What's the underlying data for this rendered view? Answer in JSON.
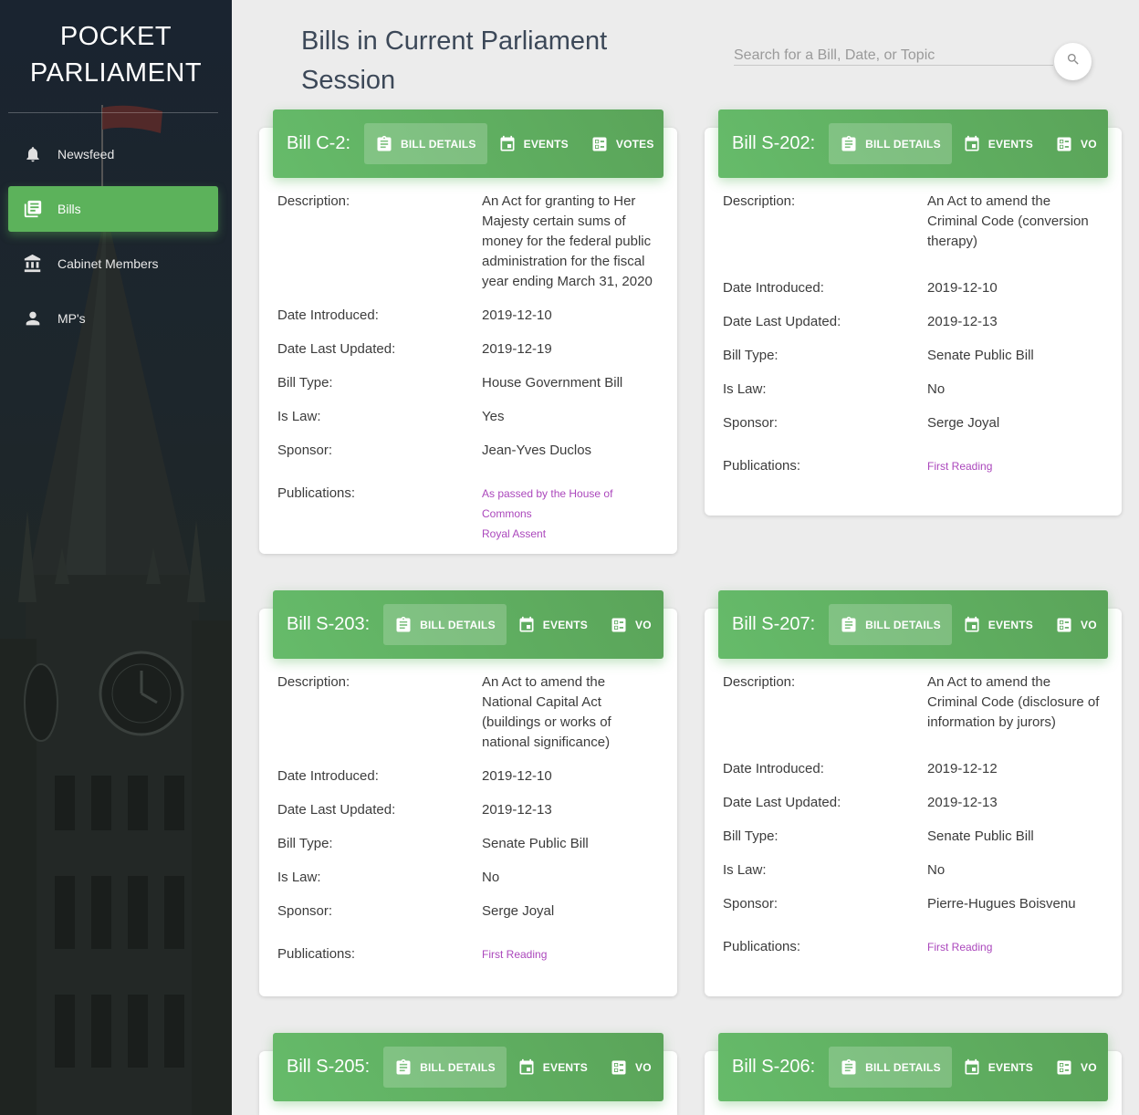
{
  "brand": {
    "line1": "POCKET",
    "line2": "PARLIAMENT"
  },
  "nav": [
    {
      "label": "Newsfeed",
      "icon": "bell-icon",
      "active": false
    },
    {
      "label": "Bills",
      "icon": "library-books-icon",
      "active": true
    },
    {
      "label": "Cabinet Members",
      "icon": "bank-icon",
      "active": false
    },
    {
      "label": "MP's",
      "icon": "person-icon",
      "active": false
    }
  ],
  "header": {
    "title": "Bills in Current Parliament Session",
    "search_placeholder": "Search for a Bill, Date, or Topic"
  },
  "colors": {
    "accent_green": "#5cb25b",
    "link_purple": "#ab47bc",
    "sidebar_dark": "#1d262c"
  },
  "labels": {
    "description": "Description:",
    "date_introduced": "Date Introduced:",
    "date_last_updated": "Date Last Updated:",
    "bill_type": "Bill Type:",
    "is_law": "Is Law:",
    "sponsor": "Sponsor:",
    "publications": "Publications:"
  },
  "bills": [
    {
      "number": "Bill C-2:",
      "tabs": [
        "BILL DETAILS",
        "EVENTS",
        "VOTES"
      ],
      "description": "An Act for granting to Her Majesty certain sums of money for the federal public administration for the fiscal year ending March 31, 2020",
      "date_introduced": "2019-12-10",
      "date_last_updated": "2019-12-19",
      "bill_type": "House Government Bill",
      "is_law": "Yes",
      "sponsor": "Jean-Yves Duclos",
      "publications": [
        "As passed by the House of Commons",
        "Royal Assent"
      ]
    },
    {
      "number": "Bill S-202:",
      "tabs": [
        "BILL DETAILS",
        "EVENTS",
        "VO"
      ],
      "description": "An Act to amend the Criminal Code (conversion therapy)",
      "date_introduced": "2019-12-10",
      "date_last_updated": "2019-12-13",
      "bill_type": "Senate Public Bill",
      "is_law": "No",
      "sponsor": "Serge Joyal",
      "publications": [
        "First Reading"
      ]
    },
    {
      "number": "Bill S-203:",
      "tabs": [
        "BILL DETAILS",
        "EVENTS",
        "VO"
      ],
      "description": "An Act to amend the National Capital Act (buildings or works of national significance)",
      "date_introduced": "2019-12-10",
      "date_last_updated": "2019-12-13",
      "bill_type": "Senate Public Bill",
      "is_law": "No",
      "sponsor": "Serge Joyal",
      "publications": [
        "First Reading"
      ]
    },
    {
      "number": "Bill S-207:",
      "tabs": [
        "BILL DETAILS",
        "EVENTS",
        "VO"
      ],
      "description": "An Act to amend the Criminal Code (disclosure of information by jurors)",
      "date_introduced": "2019-12-12",
      "date_last_updated": "2019-12-13",
      "bill_type": "Senate Public Bill",
      "is_law": "No",
      "sponsor": "Pierre-Hugues Boisvenu",
      "publications": [
        "First Reading"
      ]
    },
    {
      "number": "Bill S-205:",
      "tabs": [
        "BILL DETAILS",
        "EVENTS",
        "VO"
      ]
    },
    {
      "number": "Bill S-206:",
      "tabs": [
        "BILL DETAILS",
        "EVENTS",
        "VO"
      ]
    }
  ]
}
